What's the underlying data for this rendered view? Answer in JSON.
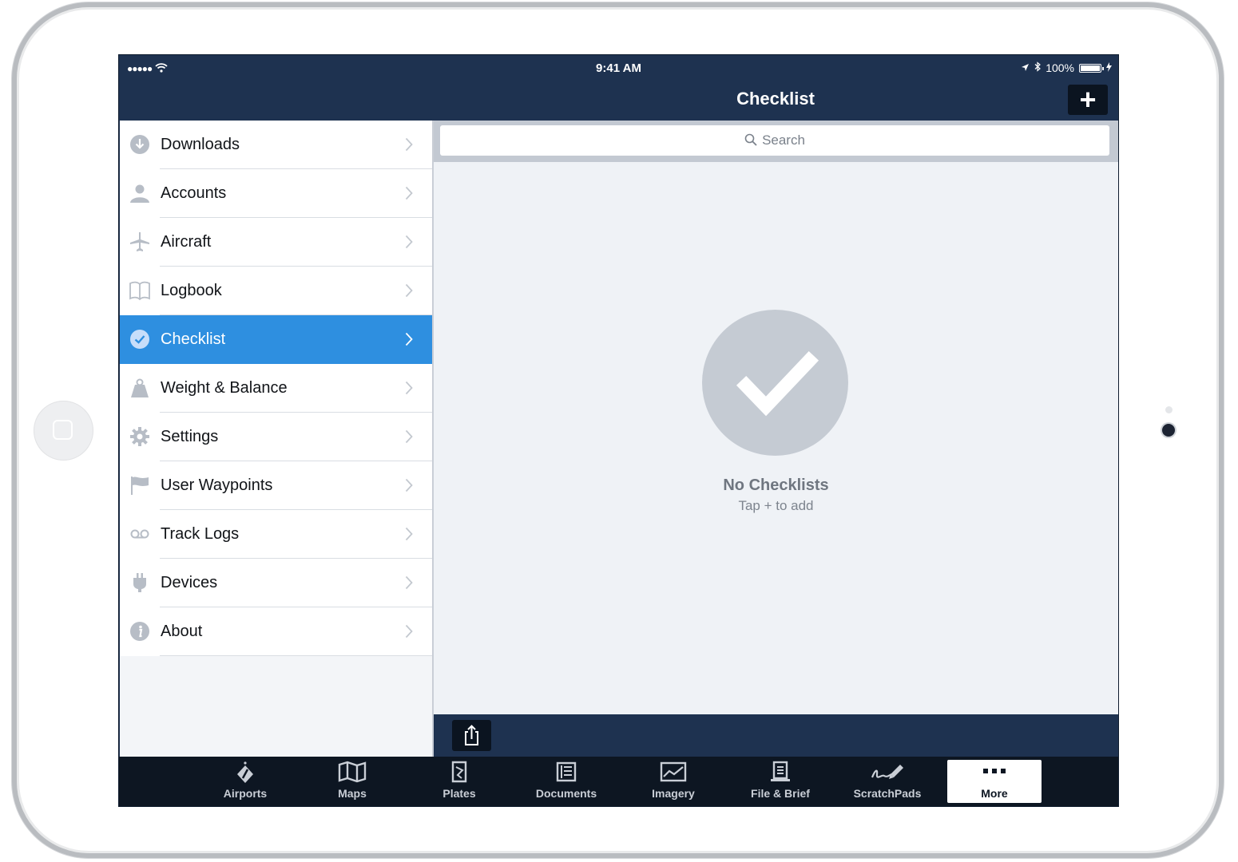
{
  "status_bar": {
    "signal": "●●●●●",
    "time": "9:41 AM",
    "battery": "100%"
  },
  "nav": {
    "title": "Checklist",
    "add_label": "+"
  },
  "sidebar": {
    "selected": "Checklist",
    "items": [
      {
        "label": "Downloads",
        "icon": "download-icon"
      },
      {
        "label": "Accounts",
        "icon": "person-icon"
      },
      {
        "label": "Aircraft",
        "icon": "airplane-icon"
      },
      {
        "label": "Logbook",
        "icon": "book-icon"
      },
      {
        "label": "Checklist",
        "icon": "check-circle-icon"
      },
      {
        "label": "Weight & Balance",
        "icon": "weight-icon"
      },
      {
        "label": "Settings",
        "icon": "gear-icon"
      },
      {
        "label": "User Waypoints",
        "icon": "flag-icon"
      },
      {
        "label": "Track Logs",
        "icon": "tracklog-icon"
      },
      {
        "label": "Devices",
        "icon": "plug-icon"
      },
      {
        "label": "About",
        "icon": "info-icon"
      }
    ]
  },
  "search": {
    "placeholder": "Search"
  },
  "empty_state": {
    "title": "No Checklists",
    "subtitle": "Tap + to add"
  },
  "tabs": [
    {
      "label": "Airports",
      "icon": "airports-icon"
    },
    {
      "label": "Maps",
      "icon": "map-icon"
    },
    {
      "label": "Plates",
      "icon": "plates-icon"
    },
    {
      "label": "Documents",
      "icon": "documents-icon"
    },
    {
      "label": "Imagery",
      "icon": "imagery-icon"
    },
    {
      "label": "File & Brief",
      "icon": "file-brief-icon"
    },
    {
      "label": "ScratchPads",
      "icon": "scratchpad-icon"
    },
    {
      "label": "More",
      "icon": "more-icon"
    }
  ],
  "colors": {
    "nav_bg": "#1e3250",
    "accent": "#2e8fe0",
    "tabbar_bg": "#0d1622"
  }
}
